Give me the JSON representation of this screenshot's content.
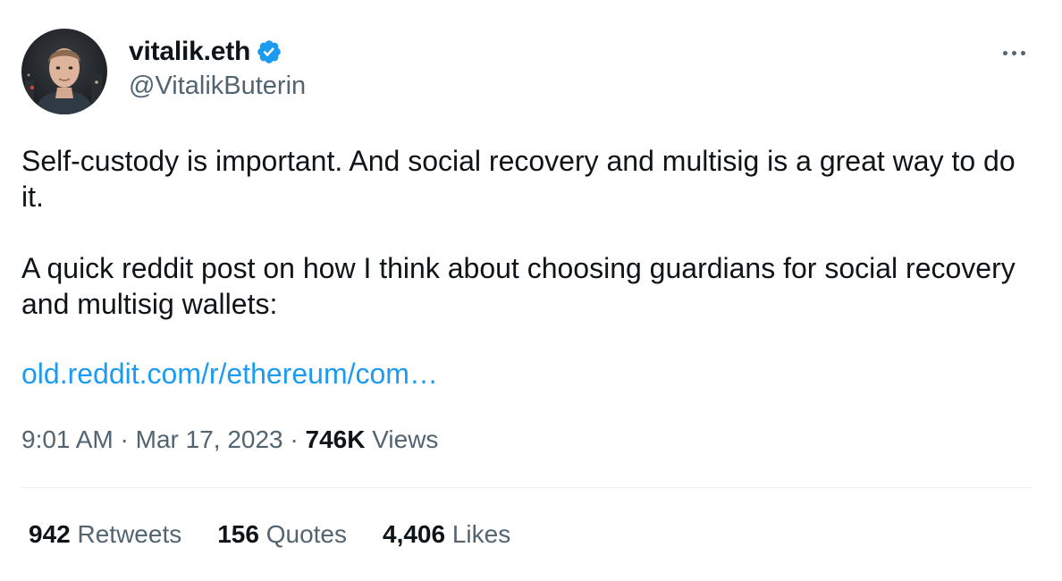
{
  "author": {
    "display_name": "vitalik.eth",
    "handle": "@VitalikButerin",
    "verified": true,
    "verified_icon": "verified-badge-icon",
    "avatar": "profile-photo"
  },
  "menu": {
    "more_icon": "more-options-icon"
  },
  "tweet": {
    "paragraphs": [
      "Self-custody is important. And social recovery and multisig is a great way to do it.",
      "A quick reddit post on how I think about choosing guardians for social recovery and multisig wallets:"
    ],
    "link_text": "old.reddit.com/r/ethereum/com…"
  },
  "meta": {
    "time": "9:01 AM",
    "separator": "·",
    "date": "Mar 17, 2023",
    "views_count": "746K",
    "views_label": "Views"
  },
  "stats": [
    {
      "count": "942",
      "label": "Retweets"
    },
    {
      "count": "156",
      "label": "Quotes"
    },
    {
      "count": "4,406",
      "label": "Likes"
    }
  ],
  "colors": {
    "text_primary": "#0f1419",
    "text_secondary": "#536471",
    "link": "#1d9bf0",
    "verified": "#1d9bf0",
    "divider": "#eff3f4"
  }
}
